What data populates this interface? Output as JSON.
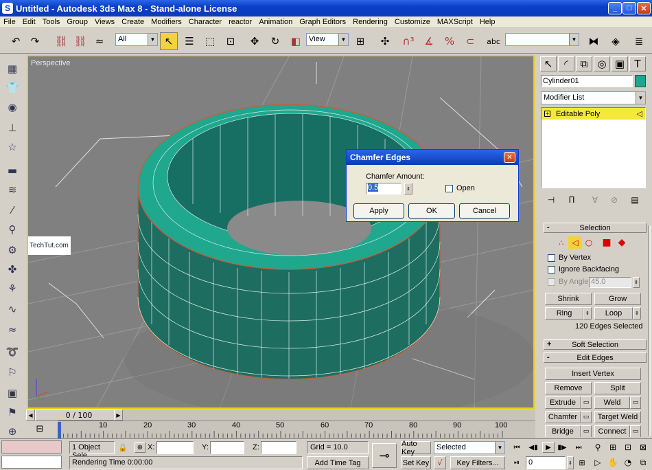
{
  "title": "Untitled - Autodesk 3ds Max 8  - Stand-alone License",
  "menu": [
    "File",
    "Edit",
    "Tools",
    "Group",
    "Views",
    "Create",
    "Modifiers",
    "Character",
    "reactor",
    "Animation",
    "Graph Editors",
    "Rendering",
    "Customize",
    "MAXScript",
    "Help"
  ],
  "toolbar": {
    "filter_value": "All",
    "refcoord_value": "View",
    "named_sel_value": ""
  },
  "viewport": {
    "label": "Perspective",
    "watermark": "TechTut.com"
  },
  "dialog": {
    "title": "Chamfer Edges",
    "amount_label": "Chamfer Amount:",
    "amount_value": "0.5",
    "open_label": "Open",
    "apply_label": "Apply",
    "ok_label": "OK",
    "cancel_label": "Cancel"
  },
  "command_panel": {
    "object_name": "Cylinder01",
    "modifier_list": "Modifier List",
    "stack_item": "Editable Poly",
    "selection": {
      "header": "Selection",
      "by_vertex": "By Vertex",
      "ignore_backfacing": "Ignore Backfacing",
      "by_angle": "By Angle:",
      "angle_value": "45.0",
      "shrink": "Shrink",
      "grow": "Grow",
      "ring": "Ring",
      "loop": "Loop",
      "status": "120 Edges Selected"
    },
    "soft_selection": "Soft Selection",
    "edit_edges": {
      "header": "Edit Edges",
      "insert_vertex": "Insert Vertex",
      "remove": "Remove",
      "split": "Split",
      "extrude": "Extrude",
      "weld": "Weld",
      "chamfer": "Chamfer",
      "target_weld": "Target Weld",
      "bridge": "Bridge",
      "connect": "Connect"
    },
    "accent_color": "#1aa88e"
  },
  "timeline": {
    "slider_label": "0 / 100",
    "ticks": [
      "10",
      "20",
      "30",
      "40",
      "50",
      "60",
      "70",
      "80",
      "90",
      "100"
    ],
    "current_frame": 0,
    "total_frames": 100
  },
  "status": {
    "selection": "1 Object Sele",
    "x_label": "X:",
    "y_label": "Y:",
    "z_label": "Z:",
    "grid": "Grid = 10.0",
    "rendering_time": "Rendering Time  0:00:00",
    "add_time_tag": "Add Time Tag",
    "auto_key": "Auto Key",
    "set_key": "Set Key",
    "selected": "Selected",
    "key_filters": "Key Filters...",
    "frame": "0"
  }
}
